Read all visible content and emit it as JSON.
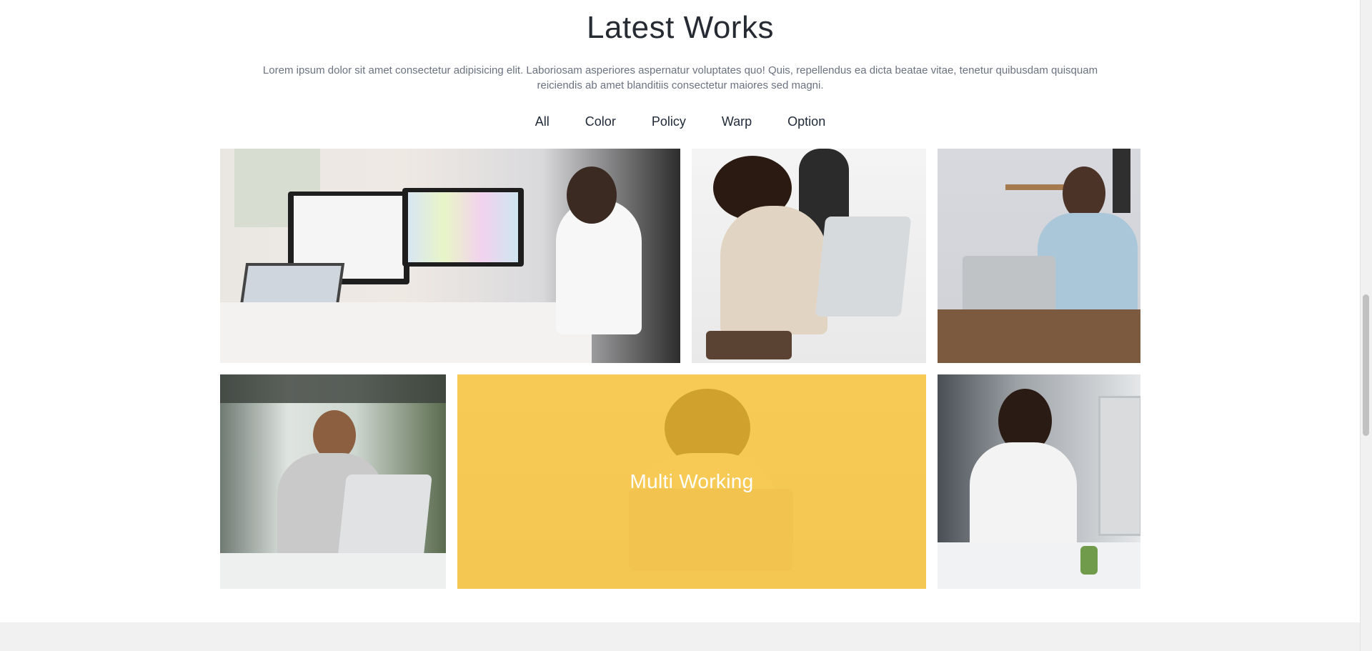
{
  "section": {
    "title": "Latest Works",
    "description": "Lorem ipsum dolor sit amet consectetur adipisicing elit. Laboriosam asperiores aspernatur voluptates quo! Quis, repellendus ea dicta beatae vitae, tenetur quibusdam quisquam reiciendis ab amet blanditiis consectetur maiores sed magni."
  },
  "filters": [
    "All",
    "Color",
    "Policy",
    "Warp",
    "Option"
  ],
  "gallery": {
    "hover_caption": "Multi Working"
  },
  "colors": {
    "accent": "#fbc330",
    "title": "#262b33",
    "text": "#6b7280",
    "footer_band": "#f1f1f1"
  },
  "icons": {
    "tile_1": "office-invoice-photo",
    "tile_2": "pair-at-laptop-photo",
    "tile_3": "man-laptop-photo",
    "tile_4": "woman-window-laptop-photo",
    "tile_5": "woman-writing-photo",
    "tile_6": "woman-phone-desk-photo"
  }
}
